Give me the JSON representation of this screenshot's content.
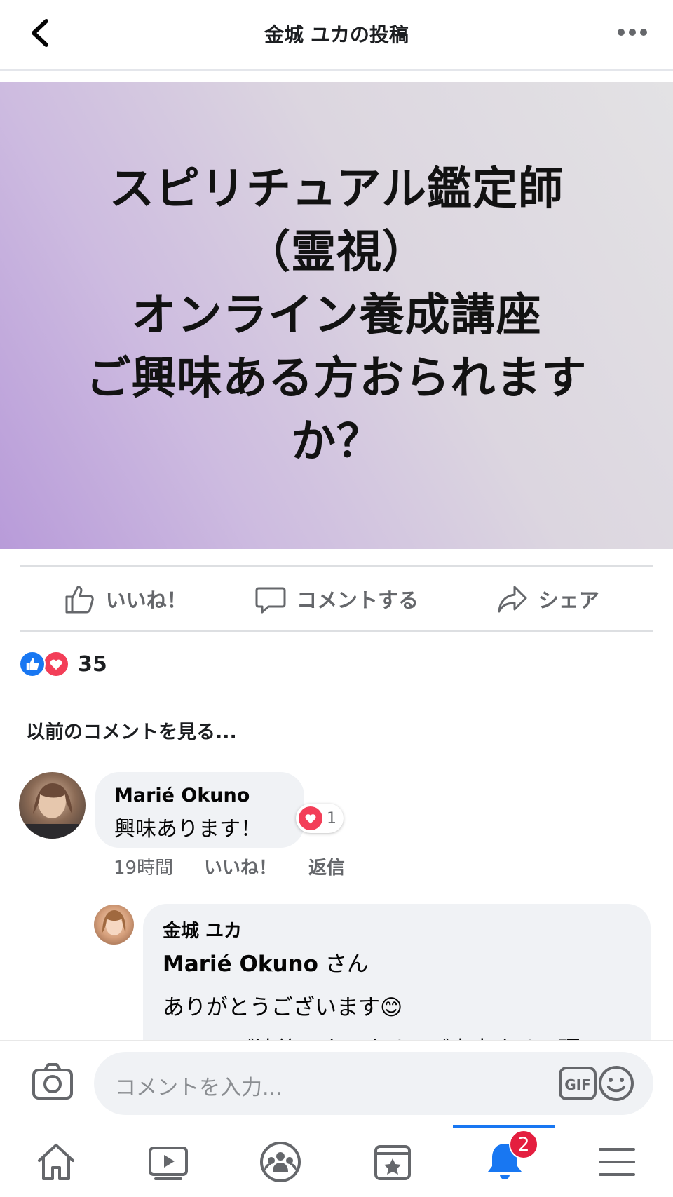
{
  "header": {
    "title": "金城 ユカの投稿"
  },
  "post": {
    "image_text": "スピリチュアル鑑定師\n（霊視）\nオンライン養成講座\nご興味ある方おられます\nか？"
  },
  "actions": {
    "like": "いいね！",
    "comment": "コメントする",
    "share": "シェア"
  },
  "reactions": {
    "count": "35"
  },
  "comments": {
    "view_previous": "以前のコメントを見る...",
    "items": [
      {
        "name": "Marié Okuno",
        "text": "興味あります！",
        "time": "19時間",
        "like": "いいね！",
        "reply": "返信",
        "reaction_count": "1"
      }
    ],
    "reply": {
      "name": "金城 ユカ",
      "mention": "Marié Okuno",
      "mention_suffix": " さん",
      "line1": "ありがとうございます😊",
      "line2": "LINEでご連絡下さいませ。ご案内させて頂"
    }
  },
  "composer": {
    "placeholder": "コメントを入力..."
  },
  "nav": {
    "notifications_badge": "2"
  },
  "colors": {
    "accent": "#1877f2",
    "love": "#f33e58",
    "badge": "#e41e3f"
  }
}
